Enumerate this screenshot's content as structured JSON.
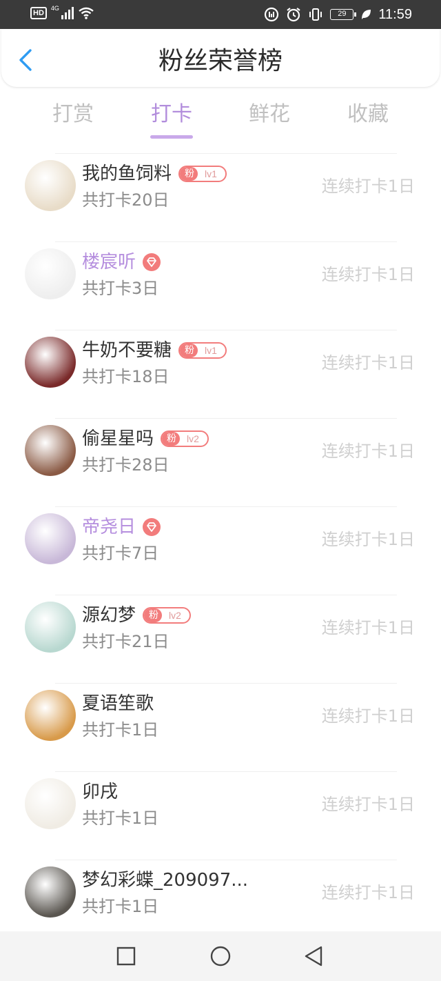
{
  "status_bar": {
    "hd": "HD",
    "network": "4G",
    "battery": "29",
    "time": "11:59",
    "icons": [
      "signal-icon",
      "wifi-icon",
      "data-saver-icon",
      "alarm-icon",
      "vibrate-icon",
      "battery-icon",
      "leaf-icon"
    ]
  },
  "header": {
    "title": "粉丝荣誉榜",
    "back_icon": "chevron-left-icon"
  },
  "tabs": [
    {
      "label": "打赏"
    },
    {
      "label": "打卡"
    },
    {
      "label": "鲜花"
    },
    {
      "label": "收藏"
    }
  ],
  "active_tab": "打卡",
  "fan_badge_label": "粉",
  "colors": {
    "accent_purple": "#b28ddc",
    "fan_badge": "#f27c7c",
    "muted": "#cfcfcf",
    "status_bar": "#3a3a3a"
  },
  "fans": [
    {
      "name": "我的鱼饲料",
      "badge": "fan",
      "level": "lv1",
      "total": "共打卡20日",
      "streak": "连续打卡1日",
      "avatar_color": "#e8dcc8"
    },
    {
      "name": "楼宸听",
      "badge": "diamond",
      "level": "",
      "total": "共打卡3日",
      "streak": "连续打卡1日",
      "avatar_color": "#eeeeee"
    },
    {
      "name": "牛奶不要糖",
      "badge": "fan",
      "level": "lv1",
      "total": "共打卡18日",
      "streak": "连续打卡1日",
      "avatar_color": "#7a2a2a"
    },
    {
      "name": "偷星星吗",
      "badge": "fan",
      "level": "lv2",
      "total": "共打卡28日",
      "streak": "连续打卡1日",
      "avatar_color": "#8a5a44"
    },
    {
      "name": "帝尧日",
      "badge": "diamond",
      "level": "",
      "total": "共打卡7日",
      "streak": "连续打卡1日",
      "avatar_color": "#c8b8d8"
    },
    {
      "name": "源幻梦",
      "badge": "fan",
      "level": "lv2",
      "total": "共打卡21日",
      "streak": "连续打卡1日",
      "avatar_color": "#b8d8d0"
    },
    {
      "name": "夏语笙歌",
      "badge": "",
      "level": "",
      "total": "共打卡1日",
      "streak": "连续打卡1日",
      "avatar_color": "#d89a4a"
    },
    {
      "name": "卯戌",
      "badge": "",
      "level": "",
      "total": "共打卡1日",
      "streak": "连续打卡1日",
      "avatar_color": "#f0ece4"
    },
    {
      "name": "梦幻彩蝶_209097...",
      "badge": "",
      "level": "",
      "total": "共打卡1日",
      "streak": "连续打卡1日",
      "avatar_color": "#5a5650"
    }
  ],
  "nav_bar": {
    "icons": [
      "recent-apps-icon",
      "home-icon",
      "back-triangle-icon"
    ]
  }
}
